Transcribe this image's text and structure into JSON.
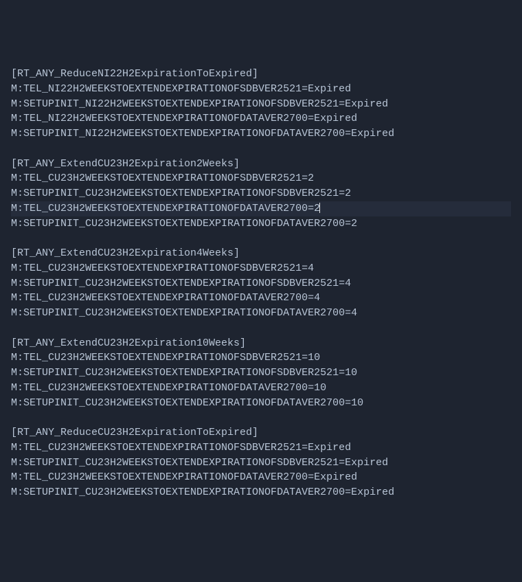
{
  "sections": [
    {
      "header": "[RT_ANY_ReduceNI22H2ExpirationToExpired]",
      "lines": [
        "M:TEL_NI22H2WEEKSTOEXTENDEXPIRATIONOFSDBVER2521=Expired",
        "M:SETUPINIT_NI22H2WEEKSTOEXTENDEXPIRATIONOFSDBVER2521=Expired",
        "M:TEL_NI22H2WEEKSTOEXTENDEXPIRATIONOFDATAVER2700=Expired",
        "M:SETUPINIT_NI22H2WEEKSTOEXTENDEXPIRATIONOFDATAVER2700=Expired"
      ]
    },
    {
      "header": "[RT_ANY_ExtendCU23H2Expiration2Weeks]",
      "lines": [
        "M:TEL_CU23H2WEEKSTOEXTENDEXPIRATIONOFSDBVER2521=2",
        "M:SETUPINIT_CU23H2WEEKSTOEXTENDEXPIRATIONOFSDBVER2521=2",
        "M:TEL_CU23H2WEEKSTOEXTENDEXPIRATIONOFDATAVER2700=2",
        "M:SETUPINIT_CU23H2WEEKSTOEXTENDEXPIRATIONOFDATAVER2700=2"
      ],
      "cursor_line_index": 2
    },
    {
      "header": "[RT_ANY_ExtendCU23H2Expiration4Weeks]",
      "lines": [
        "M:TEL_CU23H2WEEKSTOEXTENDEXPIRATIONOFSDBVER2521=4",
        "M:SETUPINIT_CU23H2WEEKSTOEXTENDEXPIRATIONOFSDBVER2521=4",
        "M:TEL_CU23H2WEEKSTOEXTENDEXPIRATIONOFDATAVER2700=4",
        "M:SETUPINIT_CU23H2WEEKSTOEXTENDEXPIRATIONOFDATAVER2700=4"
      ]
    },
    {
      "header": "[RT_ANY_ExtendCU23H2Expiration10Weeks]",
      "lines": [
        "M:TEL_CU23H2WEEKSTOEXTENDEXPIRATIONOFSDBVER2521=10",
        "M:SETUPINIT_CU23H2WEEKSTOEXTENDEXPIRATIONOFSDBVER2521=10",
        "M:TEL_CU23H2WEEKSTOEXTENDEXPIRATIONOFDATAVER2700=10",
        "M:SETUPINIT_CU23H2WEEKSTOEXTENDEXPIRATIONOFDATAVER2700=10"
      ]
    },
    {
      "header": "[RT_ANY_ReduceCU23H2ExpirationToExpired]",
      "lines": [
        "M:TEL_CU23H2WEEKSTOEXTENDEXPIRATIONOFSDBVER2521=Expired",
        "M:SETUPINIT_CU23H2WEEKSTOEXTENDEXPIRATIONOFSDBVER2521=Expired",
        "M:TEL_CU23H2WEEKSTOEXTENDEXPIRATIONOFDATAVER2700=Expired",
        "M:SETUPINIT_CU23H2WEEKSTOEXTENDEXPIRATIONOFDATAVER2700=Expired"
      ]
    }
  ]
}
